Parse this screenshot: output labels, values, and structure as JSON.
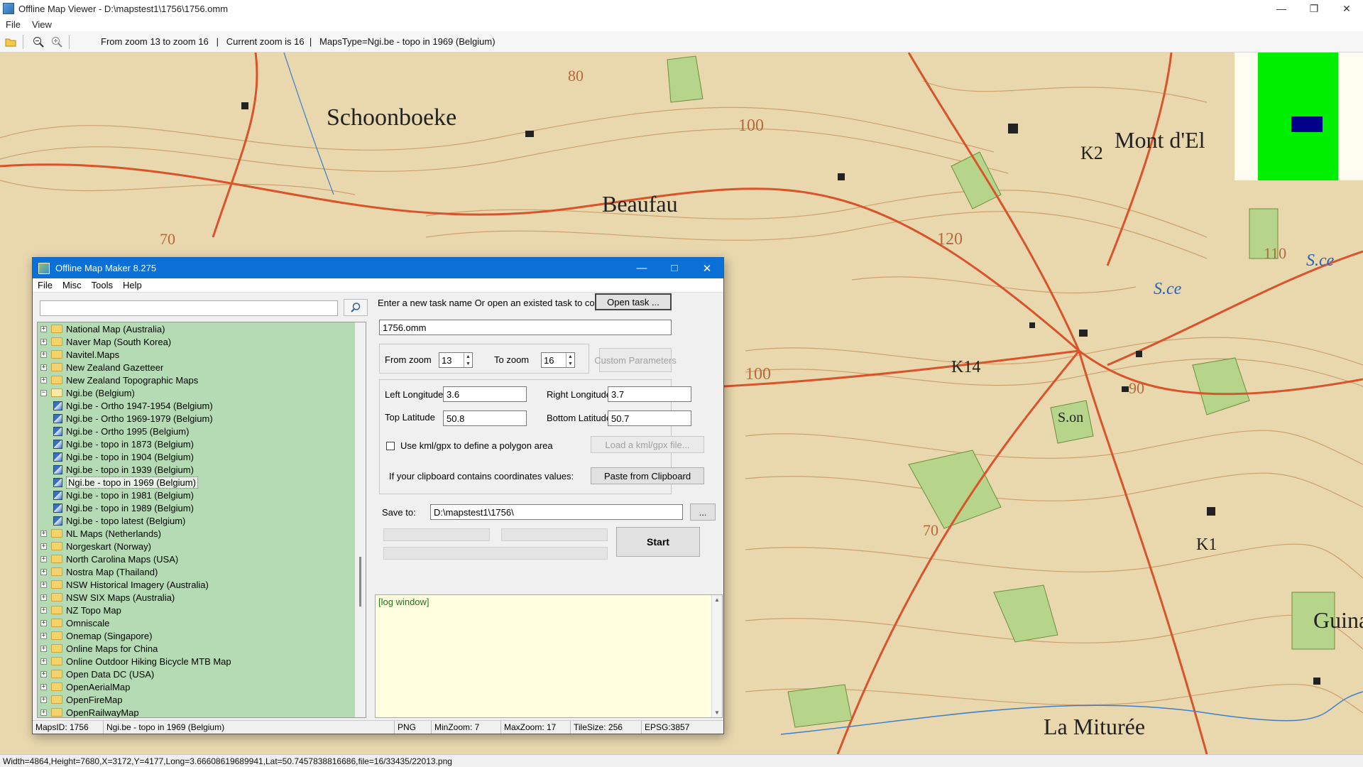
{
  "viewer": {
    "title": "Offline Map Viewer - D:\\mapstest1\\1756\\1756.omm",
    "menu": [
      "File",
      "View"
    ],
    "toolbar_status": "From zoom 13 to zoom 16   |   Current zoom is 16  |   MapsType=Ngi.be - topo in 1969 (Belgium)",
    "statusbar": "Width=4864,Height=7680,X=3172,Y=4177,Long=3.66608619689941,Lat=50.7457838816686,file=16/33435/22013.png",
    "map_labels": [
      "Schoonboeke",
      "Beaufau",
      "Mont d'El",
      "K2",
      "K14",
      "K1",
      "Guina",
      "La Miturée",
      "S.ce",
      "S.ce",
      "S.on",
      "100",
      "120",
      "110",
      "100",
      "90",
      "70",
      "80",
      "70"
    ]
  },
  "dialog": {
    "title": "Offline Map Maker 8.275",
    "menu": [
      "File",
      "Misc",
      "Tools",
      "Help"
    ],
    "search_value": "",
    "tree": [
      {
        "label": "National Map (Australia)",
        "level": 0,
        "type": "folder",
        "expander": "+"
      },
      {
        "label": "Naver Map (South Korea)",
        "level": 0,
        "type": "folder",
        "expander": "+"
      },
      {
        "label": "Navitel.Maps",
        "level": 0,
        "type": "folder",
        "expander": "+"
      },
      {
        "label": "New Zealand Gazetteer",
        "level": 0,
        "type": "folder",
        "expander": "+"
      },
      {
        "label": "New Zealand Topographic Maps",
        "level": 0,
        "type": "folder",
        "expander": "+"
      },
      {
        "label": "Ngi.be (Belgium)",
        "level": 0,
        "type": "folder-open",
        "expander": "−"
      },
      {
        "label": "Ngi.be - Ortho 1947-1954 (Belgium)",
        "level": 1,
        "type": "map"
      },
      {
        "label": "Ngi.be - Ortho 1969-1979 (Belgium)",
        "level": 1,
        "type": "map"
      },
      {
        "label": "Ngi.be - Ortho 1995 (Belgium)",
        "level": 1,
        "type": "map"
      },
      {
        "label": "Ngi.be - topo in 1873 (Belgium)",
        "level": 1,
        "type": "map"
      },
      {
        "label": "Ngi.be - topo in 1904 (Belgium)",
        "level": 1,
        "type": "map"
      },
      {
        "label": "Ngi.be - topo in 1939 (Belgium)",
        "level": 1,
        "type": "map"
      },
      {
        "label": "Ngi.be - topo in 1969 (Belgium)",
        "level": 1,
        "type": "map",
        "selected": true
      },
      {
        "label": "Ngi.be - topo in 1981 (Belgium)",
        "level": 1,
        "type": "map"
      },
      {
        "label": "Ngi.be - topo in 1989 (Belgium)",
        "level": 1,
        "type": "map"
      },
      {
        "label": "Ngi.be - topo latest (Belgium)",
        "level": 1,
        "type": "map"
      },
      {
        "label": "NL Maps (Netherlands)",
        "level": 0,
        "type": "folder",
        "expander": "+"
      },
      {
        "label": "Norgeskart (Norway)",
        "level": 0,
        "type": "folder",
        "expander": "+"
      },
      {
        "label": "North Carolina Maps (USA)",
        "level": 0,
        "type": "folder",
        "expander": "+"
      },
      {
        "label": "Nostra Map (Thailand)",
        "level": 0,
        "type": "folder",
        "expander": "+"
      },
      {
        "label": "NSW Historical Imagery (Australia)",
        "level": 0,
        "type": "folder",
        "expander": "+"
      },
      {
        "label": "NSW SIX Maps (Australia)",
        "level": 0,
        "type": "folder",
        "expander": "+"
      },
      {
        "label": "NZ Topo Map",
        "level": 0,
        "type": "folder",
        "expander": "+"
      },
      {
        "label": "Omniscale",
        "level": 0,
        "type": "folder",
        "expander": "+"
      },
      {
        "label": "Onemap (Singapore)",
        "level": 0,
        "type": "folder",
        "expander": "+"
      },
      {
        "label": "Online Maps for China",
        "level": 0,
        "type": "folder",
        "expander": "+"
      },
      {
        "label": "Online Outdoor Hiking Bicycle MTB Map",
        "level": 0,
        "type": "folder",
        "expander": "+"
      },
      {
        "label": "Open Data DC (USA)",
        "level": 0,
        "type": "folder",
        "expander": "+"
      },
      {
        "label": "OpenAerialMap",
        "level": 0,
        "type": "folder",
        "expander": "+"
      },
      {
        "label": "OpenFireMap",
        "level": 0,
        "type": "folder",
        "expander": "+"
      },
      {
        "label": "OpenRailwayMap",
        "level": 0,
        "type": "folder",
        "expander": "+"
      }
    ],
    "task_prompt": "Enter a new task name Or open an existed task to continue:",
    "open_task_label": "Open task ...",
    "task_name": "1756.omm",
    "from_zoom_label": "From zoom",
    "from_zoom": "13",
    "to_zoom_label": "To zoom",
    "to_zoom": "16",
    "custom_params_label": "Custom Parameters",
    "left_lon_label": "Left Longitude",
    "left_lon": "3.6",
    "right_lon_label": "Right Longitude",
    "right_lon": "3.7",
    "top_lat_label": "Top Latitude",
    "top_lat": "50.8",
    "bottom_lat_label": "Bottom Latitude",
    "bottom_lat": "50.7",
    "use_kml_label": "Use kml/gpx to define a polygon area",
    "load_kml_label": "Load a kml/gpx file...",
    "clipboard_prompt": "If your clipboard contains coordinates values:",
    "paste_label": "Paste from Clipboard",
    "save_to_label": "Save to:",
    "save_path": "D:\\mapstest1\\1756\\",
    "browse_label": "...",
    "start_label": "Start",
    "log_text": "[log window]",
    "status": {
      "maps_id": "MapsID: 1756",
      "maps_name": "Ngi.be - topo in 1969 (Belgium)",
      "format": "PNG",
      "min_zoom": "MinZoom: 7",
      "max_zoom": "MaxZoom: 17",
      "tile_size": "TileSize: 256",
      "epsg": "EPSG:3857"
    }
  },
  "colors": {
    "map_paper": "#e9d7ae",
    "road": "#d9542a",
    "contour": "#c9925a",
    "forest": "#b6d48a",
    "tree_bg": "#b5dbb5",
    "title_blue": "#0a6fd6",
    "log_bg": "#ffffe0"
  }
}
